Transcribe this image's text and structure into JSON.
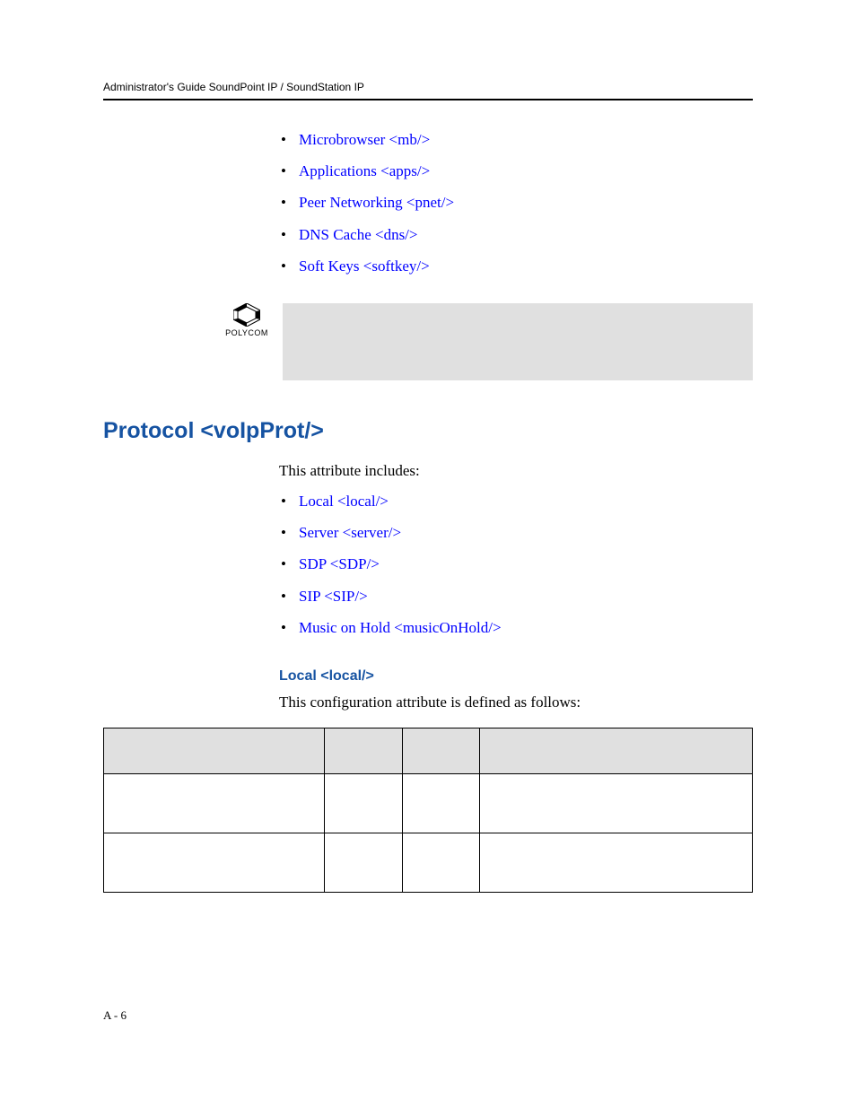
{
  "header": {
    "running_title": "Administrator's Guide SoundPoint IP / SoundStation IP"
  },
  "top_list": [
    "Microbrowser <mb/>",
    "Applications <apps/>",
    "Peer Networking <pnet/>",
    "DNS Cache <dns/>",
    "Soft Keys <softkey/>"
  ],
  "note_logo_text": "POLYCOM",
  "section": {
    "h2": "Protocol <voIpProt/>",
    "intro": "This attribute includes:",
    "sub_list": [
      "Local <local/>",
      "Server <server/>",
      "SDP <SDP/>",
      "SIP <SIP/>",
      "Music on Hold <musicOnHold/>"
    ],
    "h3": "Local <local/>",
    "h3_intro": "This configuration attribute is defined as follows:"
  },
  "table": {
    "headers": [
      "",
      "",
      "",
      ""
    ],
    "rows": [
      [
        "",
        "",
        "",
        ""
      ],
      [
        "",
        "",
        "",
        ""
      ]
    ]
  },
  "page_number": "A - 6"
}
